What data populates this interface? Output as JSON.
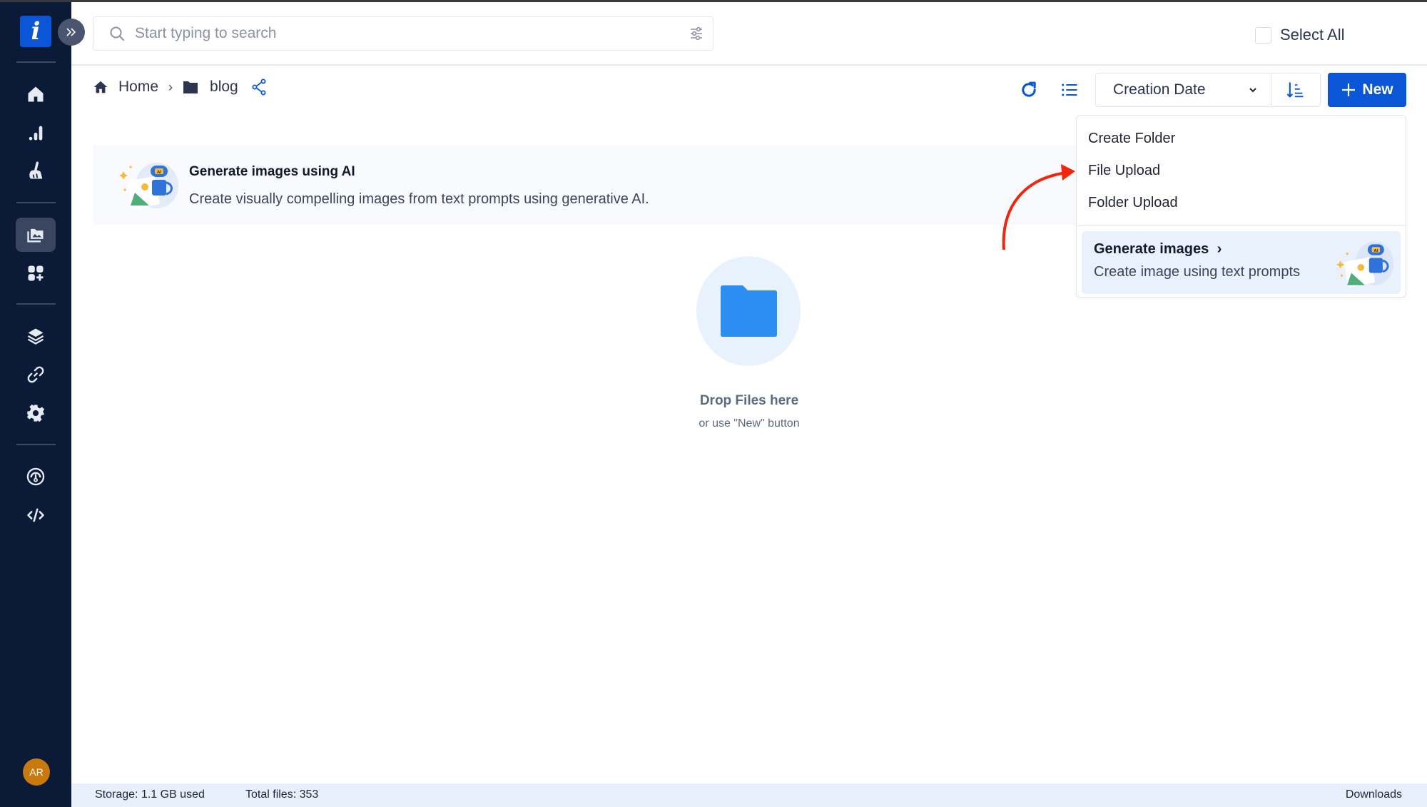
{
  "app": {
    "logo_letter": "i",
    "expand_icon": "chevrons-right-icon"
  },
  "sidebar": {
    "items": [
      {
        "name": "home",
        "icon": "home-icon",
        "active": false
      },
      {
        "name": "analytics",
        "icon": "bar-chart-icon",
        "active": false
      },
      {
        "name": "cleanup",
        "icon": "broom-icon",
        "active": false
      },
      {
        "name": "media-library",
        "icon": "images-icon",
        "active": true
      },
      {
        "name": "add-apps",
        "icon": "apps-add-icon",
        "active": false
      },
      {
        "name": "layers",
        "icon": "layers-icon",
        "active": false
      },
      {
        "name": "links",
        "icon": "link-icon",
        "active": false
      },
      {
        "name": "settings",
        "icon": "gear-icon",
        "active": false
      },
      {
        "name": "usage",
        "icon": "gauge-icon",
        "active": false
      },
      {
        "name": "developer",
        "icon": "code-icon",
        "active": false
      }
    ],
    "avatar_initials": "AR",
    "avatar_color": "#c97a0e"
  },
  "header": {
    "search_placeholder": "Start typing to search",
    "select_all_label": "Select All"
  },
  "breadcrumb": {
    "home_label": "Home",
    "separator": "›",
    "folder_label": "blog"
  },
  "toolbar": {
    "sort_field": "Creation Date",
    "new_label": "New"
  },
  "banner": {
    "title": "Generate images using AI",
    "description": "Create visually compelling images from text prompts using generative AI."
  },
  "new_menu": {
    "items": [
      "Create Folder",
      "File Upload",
      "Folder Upload"
    ],
    "generate": {
      "title": "Generate images",
      "chevron": "›",
      "description": "Create image using text prompts"
    }
  },
  "empty_state": {
    "title": "Drop Files here",
    "subtitle": "or use \"New\" button"
  },
  "footer": {
    "storage": "Storage: 1.1 GB used",
    "total_files": "Total files: 353",
    "downloads": "Downloads"
  },
  "colors": {
    "sidebar_bg": "#0b1a36",
    "accent": "#0a56d6",
    "annotation_arrow": "#f2250f",
    "footer_bg": "#e8f1fb"
  }
}
